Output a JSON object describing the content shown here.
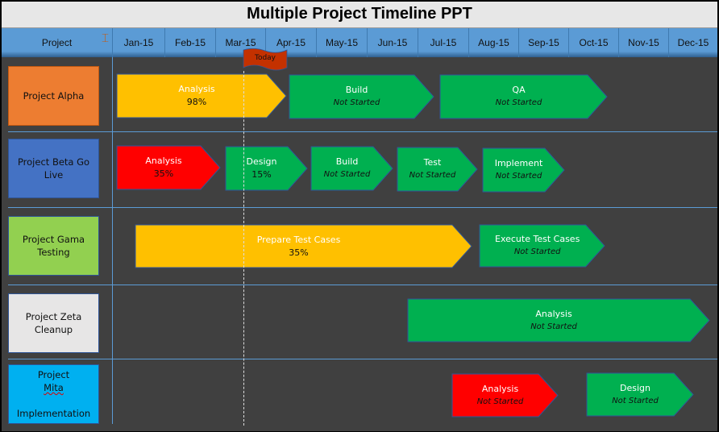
{
  "title": "Multiple Project Timeline PPT",
  "header": {
    "project_label": "Project",
    "months": [
      "Jan-15",
      "Feb-15",
      "Mar-15",
      "Apr-15",
      "May-15",
      "Jun-15",
      "Jul-15",
      "Aug-15",
      "Sep-15",
      "Oct-15",
      "Nov-15",
      "Dec-15"
    ]
  },
  "today_marker": {
    "label": "Today",
    "color": "#c43100"
  },
  "colors": {
    "in_progress": "#ffc000",
    "not_started": "#00b050",
    "at_risk": "#ff0000"
  },
  "projects": [
    {
      "name": "Project Alpha",
      "color": "#ed7d31",
      "tasks": [
        {
          "name": "Analysis",
          "status": "98%",
          "color": "#ffc000"
        },
        {
          "name": "Build",
          "status": "Not Started",
          "color": "#00b050"
        },
        {
          "name": "QA",
          "status": "Not Started",
          "color": "#00b050"
        }
      ]
    },
    {
      "name": "Project Beta Go Live",
      "color": "#4472c4",
      "tasks": [
        {
          "name": "Analysis",
          "status": "35%",
          "color": "#ff0000"
        },
        {
          "name": "Design",
          "status": "15%",
          "color": "#00b050"
        },
        {
          "name": "Build",
          "status": "Not Started",
          "color": "#00b050"
        },
        {
          "name": "Test",
          "status": "Not Started",
          "color": "#00b050"
        },
        {
          "name": "Implement",
          "status": "Not Started",
          "color": "#00b050"
        }
      ]
    },
    {
      "name": "Project Gama Testing",
      "color": "#92d050",
      "tasks": [
        {
          "name": "Prepare Test Cases",
          "status": "35%",
          "color": "#ffc000"
        },
        {
          "name": "Execute Test Cases",
          "status": "Not Started",
          "color": "#00b050"
        }
      ]
    },
    {
      "name": "Project Zeta Cleanup",
      "color": "#e7e6e6",
      "tasks": [
        {
          "name": "Analysis",
          "status": "Not Started",
          "color": "#00b050"
        }
      ]
    },
    {
      "name_part1": "Project ",
      "name_part2": "Mita",
      "name_part3": "Implementation",
      "name": "Project Mita Implementation",
      "color": "#00b0f0",
      "tasks": [
        {
          "name": "Analysis",
          "status": "Not Started",
          "color": "#ff0000"
        },
        {
          "name": "Design",
          "status": "Not Started",
          "color": "#00b050"
        }
      ]
    }
  ]
}
